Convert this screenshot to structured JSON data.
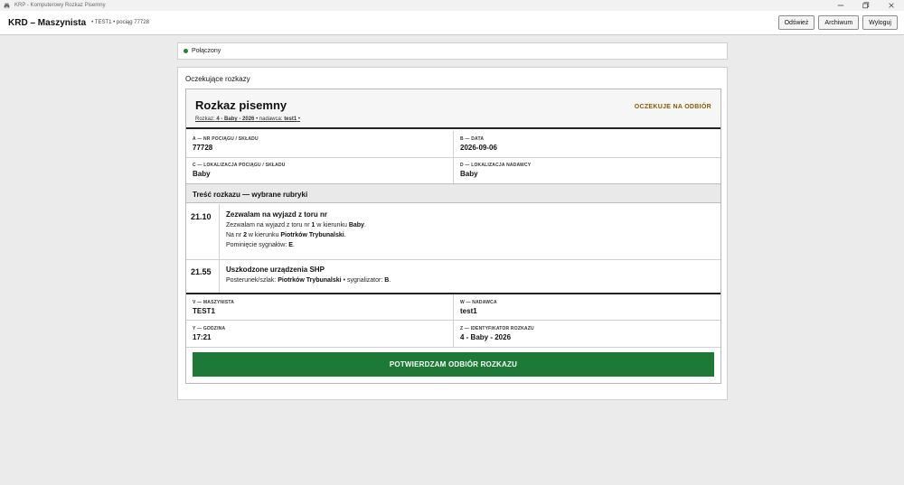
{
  "window": {
    "title": "KRP - Komputerowy Rozkaz Pisemny",
    "icon": "printer-icon",
    "controls": [
      "minimize-icon",
      "maximize-icon",
      "close-icon"
    ]
  },
  "header": {
    "app_name": "KRD – Maszynista",
    "session": "• TEST1 • pociąg 77728",
    "buttons": {
      "refresh": "Odśwież",
      "archive": "Archiwum",
      "logout": "Wyloguj"
    }
  },
  "status": {
    "text": "Połączony",
    "color": "#1a8a2e"
  },
  "panel": {
    "title": "Oczekujące rozkazy"
  },
  "order": {
    "title": "Rozkaz pisemny",
    "sub_prefix": "Rozkaz:",
    "sub_id": "4 - Baby - 2026",
    "sub_sender_prefix": "• nadawca:",
    "sub_sender": "test1",
    "sub_suffix": "•",
    "status": "OCZEKUJE NA ODBIÓR",
    "status_color": "#8a5a00",
    "fields_top": {
      "a_label": "A — NR POCIĄGU / SKŁADU",
      "a_value": "77728",
      "b_label": "B — DATA",
      "b_value": "2026-09-06",
      "c_label": "C — LOKALIZACJA POCIĄGU / SKŁADU",
      "c_value": "Baby",
      "d_label": "D — LOKALIZACJA NADAWCY",
      "d_value": "Baby"
    },
    "section_title": "Treść rozkazu — wybrane rubryki",
    "rubrics": [
      {
        "number": "21.10",
        "title": "Zezwalam na wyjazd z toru nr",
        "l1_a": "Zezwalam na wyjazd z toru nr ",
        "l1_b": "1",
        "l1_c": " w kierunku ",
        "l1_d": "Baby",
        "l1_e": ".",
        "l2_a": "Na nr ",
        "l2_b": "2",
        "l2_c": " w kierunku ",
        "l2_d": "Piotrków Trybunalski",
        "l2_e": ".",
        "l3_a": "Pominięcie sygnałów: ",
        "l3_b": "E",
        "l3_c": "."
      },
      {
        "number": "21.55",
        "title": "Uszkodzone urządzenia SHP",
        "l1_a": "Posterunek/szlak: ",
        "l1_b": "Piotrków Trybunalski",
        "l1_c": " • sygnalizator: ",
        "l1_d": "B",
        "l1_e": "."
      }
    ],
    "fields_bottom": {
      "v_label": "V — MASZYNISTA",
      "v_value": "TEST1",
      "w_label": "W — NADAWCA",
      "w_value": "test1",
      "y_label": "Y — GODZINA",
      "y_value": "17:21",
      "z_label": "Z — IDENTYFIKATOR ROZKAZU",
      "z_value": "4 - Baby - 2026"
    },
    "confirm_label": "POTWIERDZAM ODBIÓR ROZKAZU",
    "confirm_color": "#1c7a36"
  }
}
